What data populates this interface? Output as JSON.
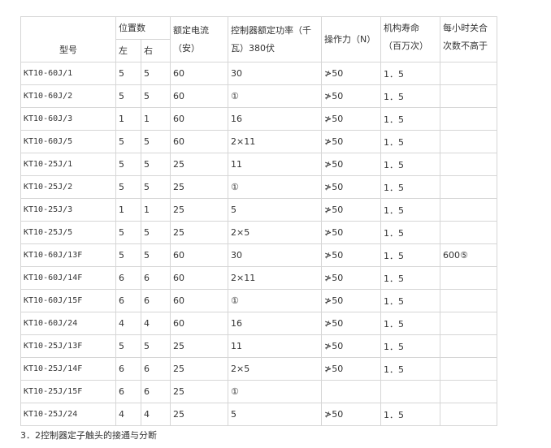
{
  "header": {
    "model": "型号",
    "positions": "位置数",
    "left": "左",
    "right": "右",
    "current_line1": "额定电流",
    "current_line2": "（安）",
    "power_line1": "控制器额定功率（千",
    "power_line2": "瓦）380伏",
    "force": "操作力（N）",
    "life_line1": "机构寿命",
    "life_line2": "（百万次）",
    "cap_line1": "每小时关合",
    "cap_line2": "次数不高于"
  },
  "rows": [
    {
      "model": "KT10-60J/1",
      "left": "5",
      "right": "5",
      "current": "60",
      "power": "30",
      "force": "≯50",
      "life": "1．5",
      "cap": ""
    },
    {
      "model": "KT10-60J/2",
      "left": "5",
      "right": "5",
      "current": "60",
      "power": "①",
      "force": "≯50",
      "life": "1．5",
      "cap": ""
    },
    {
      "model": "KT10-60J/3",
      "left": "1",
      "right": "1",
      "current": "60",
      "power": "16",
      "force": "≯50",
      "life": "1．5",
      "cap": ""
    },
    {
      "model": "KT10-60J/5",
      "left": "5",
      "right": "5",
      "current": "60",
      "power": "2×11",
      "force": "≯50",
      "life": "1．5",
      "cap": ""
    },
    {
      "model": "KT10-25J/1",
      "left": "5",
      "right": "5",
      "current": "25",
      "power": "11",
      "force": "≯50",
      "life": "1．5",
      "cap": ""
    },
    {
      "model": "KT10-25J/2",
      "left": "5",
      "right": "5",
      "current": "25",
      "power": "①",
      "force": "≯50",
      "life": "1．5",
      "cap": ""
    },
    {
      "model": "KT10-25J/3",
      "left": "1",
      "right": "1",
      "current": "25",
      "power": "5",
      "force": "≯50",
      "life": "1．5",
      "cap": ""
    },
    {
      "model": "KT10-25J/5",
      "left": "5",
      "right": "5",
      "current": "25",
      "power": "2×5",
      "force": "≯50",
      "life": "1．5",
      "cap": ""
    },
    {
      "model": "KT10-60J/13F",
      "left": "5",
      "right": "5",
      "current": "60",
      "power": "30",
      "force": "≯50",
      "life": "1．5",
      "cap": "600⑤"
    },
    {
      "model": "KT10-60J/14F",
      "left": "6",
      "right": "6",
      "current": "60",
      "power": "2×11",
      "force": "≯50",
      "life": "1．5",
      "cap": ""
    },
    {
      "model": "KT10-60J/15F",
      "left": "6",
      "right": "6",
      "current": "60",
      "power": "①",
      "force": "≯50",
      "life": "1．5",
      "cap": ""
    },
    {
      "model": "KT10-60J/24",
      "left": "4",
      "right": "4",
      "current": "60",
      "power": "16",
      "force": "≯50",
      "life": "1．5",
      "cap": ""
    },
    {
      "model": "KT10-25J/13F",
      "left": "5",
      "right": "5",
      "current": "25",
      "power": "11",
      "force": "≯50",
      "life": "1．5",
      "cap": ""
    },
    {
      "model": "KT10-25J/14F",
      "left": "6",
      "right": "6",
      "current": "25",
      "power": "2×5",
      "force": "≯50",
      "life": "1．5",
      "cap": ""
    },
    {
      "model": "KT10-25J/15F",
      "left": "6",
      "right": "6",
      "current": "25",
      "power": "①",
      "force": "",
      "life": "",
      "cap": ""
    },
    {
      "model": "KT10-25J/24",
      "left": "4",
      "right": "4",
      "current": "25",
      "power": "5",
      "force": "≯50",
      "life": "1．5",
      "cap": ""
    }
  ],
  "footnote": "3．2控制器定子触头的接通与分断"
}
